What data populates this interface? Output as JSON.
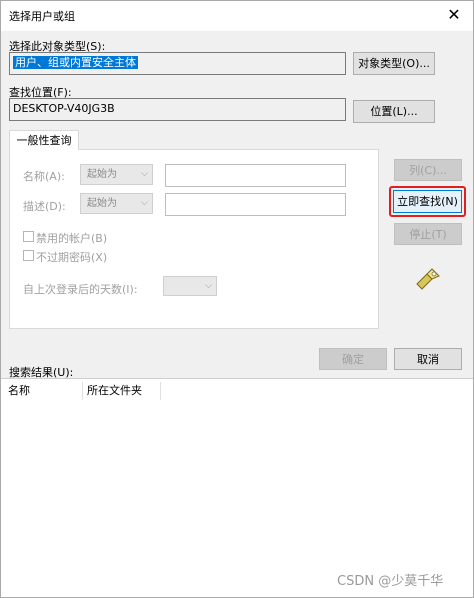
{
  "window": {
    "title": "选择用户或组",
    "close_glyph": "✕"
  },
  "object_type": {
    "label": "选择此对象类型(S):",
    "value": "用户、组或内置安全主体",
    "button": "对象类型(O)..."
  },
  "location": {
    "label": "查找位置(F):",
    "value": "DESKTOP-V40JG3B",
    "button": "位置(L)..."
  },
  "query_tab": {
    "label": "一般性查询"
  },
  "query": {
    "name_label": "名称(A):",
    "name_mode": "起始为",
    "desc_label": "描述(D):",
    "desc_mode": "起始为",
    "disabled_accounts": "禁用的帐户(B)",
    "no_expire_password": "不过期密码(X)",
    "days_since_logon": "自上次登录后的天数(I):"
  },
  "side_buttons": {
    "columns": "列(C)...",
    "find_now": "立即查找(N)",
    "stop": "停止(T)"
  },
  "actions": {
    "ok": "确定",
    "cancel": "取消"
  },
  "results": {
    "label": "搜索结果(U):",
    "columns": [
      "名称",
      "所在文件夹"
    ]
  },
  "watermark": "CSDN @少莫千华",
  "colors": {
    "selection": "#0078d7",
    "highlight_box": "#e02020"
  }
}
